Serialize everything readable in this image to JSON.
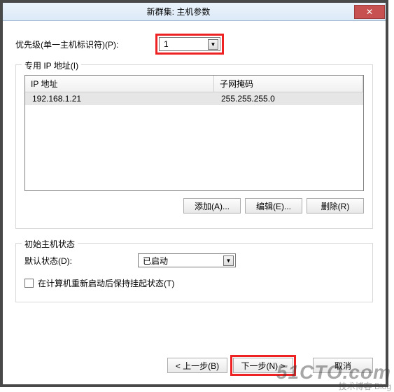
{
  "window": {
    "title": "新群集: 主机参数"
  },
  "priority": {
    "label": "优先级(单一主机标识符)(P):",
    "value": "1"
  },
  "ip_group": {
    "legend": "专用 IP 地址(I)",
    "columns": {
      "ip": "IP 地址",
      "mask": "子网掩码"
    },
    "rows": [
      {
        "ip": "192.168.1.21",
        "mask": "255.255.255.0"
      }
    ],
    "buttons": {
      "add": "添加(A)...",
      "edit": "编辑(E)...",
      "remove": "删除(R)"
    }
  },
  "initial_group": {
    "legend": "初始主机状态",
    "status_label": "默认状态(D):",
    "status_value": "已启动",
    "checkbox_label": "在计算机重新启动后保持挂起状态(T)"
  },
  "wizard": {
    "back": "< 上一步(B)",
    "next": "下一步(N) >",
    "cancel": "取消"
  },
  "watermark": {
    "line1": "51CTO.com",
    "line2": "技术博客    Blog"
  }
}
